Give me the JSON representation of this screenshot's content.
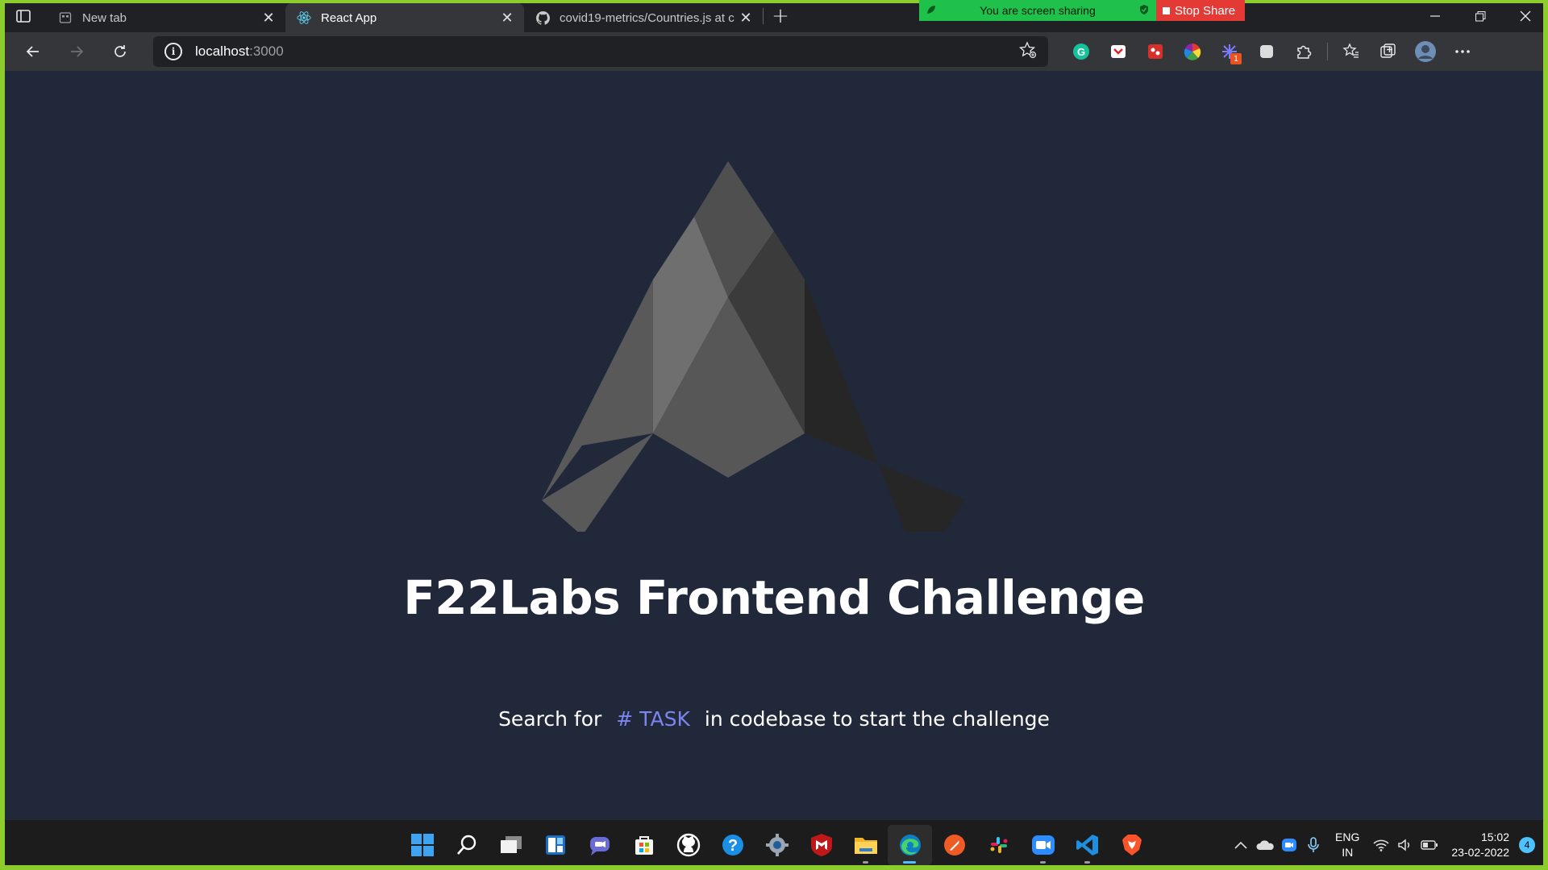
{
  "browser": {
    "tabs": [
      {
        "title": "New tab",
        "icon": "new-tab-page-icon",
        "active": false
      },
      {
        "title": "React App",
        "icon": "react-icon",
        "active": true
      },
      {
        "title": "covid19-metrics/Countries.js at c",
        "icon": "github-icon",
        "active": false
      }
    ],
    "address": {
      "host": "localhost",
      "port": ":3000"
    },
    "extensions": [
      "grammarly-icon",
      "pocket-icon",
      "red-extension-icon",
      "color-wheel-icon",
      "extension-with-badge-icon",
      "white-square-icon",
      "puzzle-icon",
      "favorites-icon",
      "collections-icon",
      "profile-avatar"
    ],
    "extension_badge": "1"
  },
  "share_banner": {
    "message": "You are screen sharing",
    "stop_label": "Stop Share"
  },
  "page": {
    "title": "F22Labs Frontend Challenge",
    "subtitle_before": "Search for",
    "task_tag": "# TASK",
    "subtitle_after": "in codebase to start the challenge"
  },
  "taskbar": {
    "apps": [
      "windows-start-icon",
      "search-icon",
      "task-view-icon",
      "widgets-icon",
      "teams-chat-icon",
      "microsoft-store-icon",
      "github-desktop-icon",
      "help-icon",
      "settings-icon",
      "mcafee-icon",
      "file-explorer-icon",
      "edge-icon",
      "postman-icon",
      "slack-icon",
      "zoom-icon",
      "vscode-icon",
      "brave-icon"
    ],
    "language": "ENG",
    "region": "IN",
    "time": "15:02",
    "date": "23-02-2022",
    "notification_count": "4"
  },
  "colors": {
    "page_bg": "#20283a",
    "share_frame": "#8ccc2c",
    "task_accent": "#7b85f0"
  }
}
